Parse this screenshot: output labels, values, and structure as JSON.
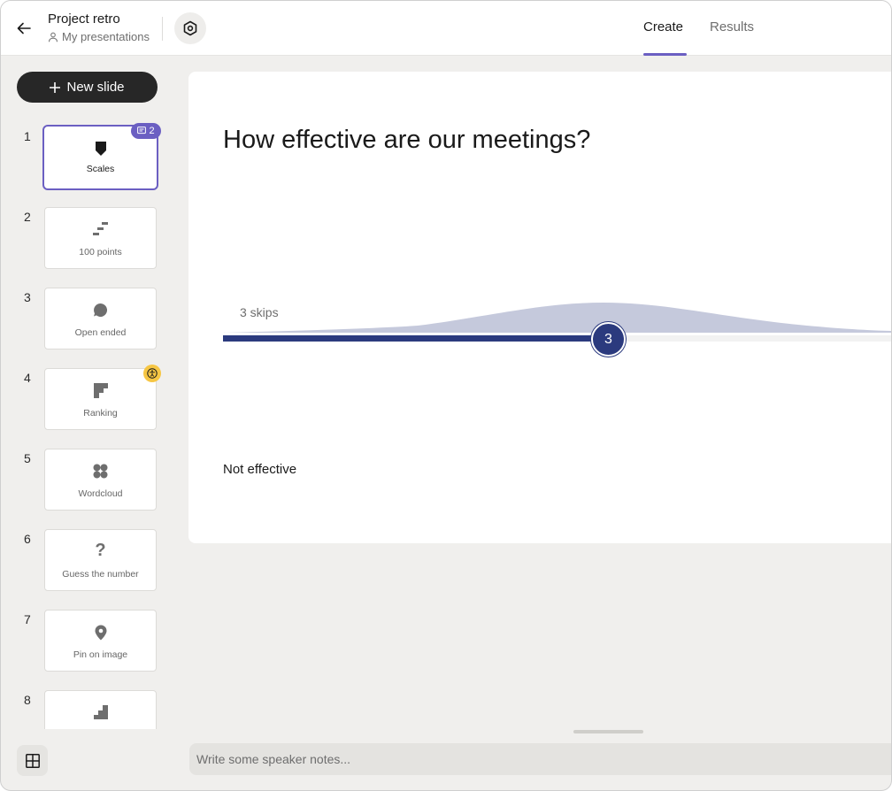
{
  "header": {
    "title": "Project retro",
    "breadcrumb": "My presentations",
    "tabs": [
      {
        "label": "Create",
        "active": true
      },
      {
        "label": "Results",
        "active": false
      }
    ]
  },
  "sidebar": {
    "new_slide_label": "New slide",
    "comment_count": "2",
    "slides": [
      {
        "number": "1",
        "label": "Scales",
        "icon": "scales-icon"
      },
      {
        "number": "2",
        "label": "100 points",
        "icon": "hundred-points-icon"
      },
      {
        "number": "3",
        "label": "Open ended",
        "icon": "speech-bubble-icon"
      },
      {
        "number": "4",
        "label": "Ranking",
        "icon": "ranking-icon"
      },
      {
        "number": "5",
        "label": "Wordcloud",
        "icon": "wordcloud-icon"
      },
      {
        "number": "6",
        "label": "Guess the number",
        "icon": "question-mark-icon"
      },
      {
        "number": "7",
        "label": "Pin on image",
        "icon": "map-pin-icon"
      },
      {
        "number": "8",
        "label": "",
        "icon": "steps-icon"
      }
    ]
  },
  "slide": {
    "question": "How effective are our meetings?",
    "skips": "3 skips",
    "value": "3",
    "min_label": "Not effective"
  },
  "notes": {
    "placeholder": "Write some speaker notes..."
  },
  "colors": {
    "accent": "#6b5fc2",
    "scale_fill": "#2b3a7e",
    "distribution": "#c5c9dc",
    "premium": "#f6c644"
  }
}
